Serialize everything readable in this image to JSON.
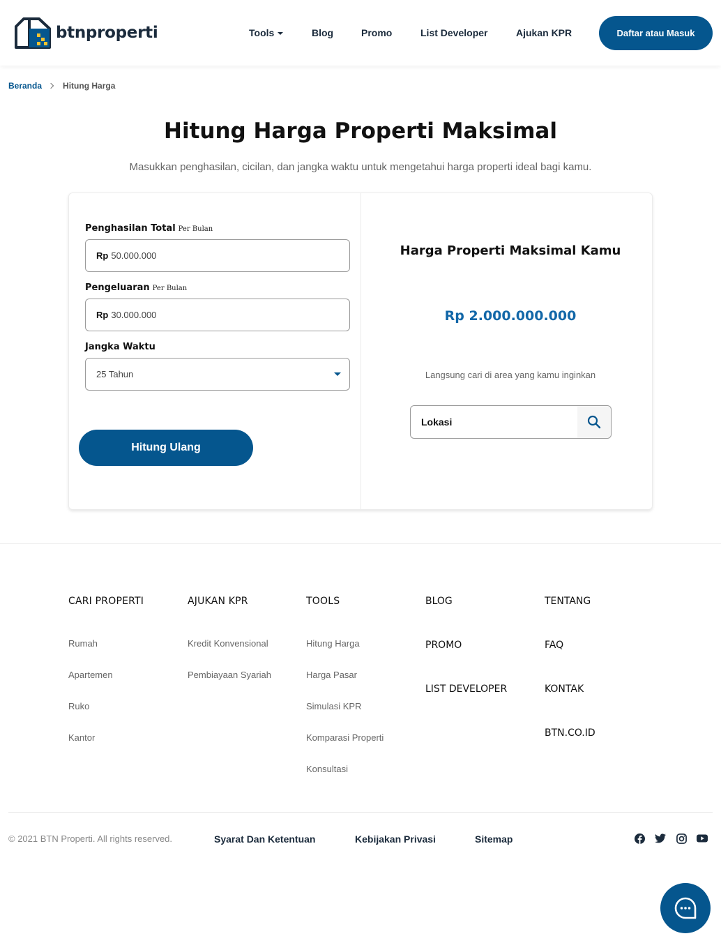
{
  "header": {
    "logo_text": "btnproperti",
    "nav": [
      {
        "label": "Tools",
        "has_dropdown": true
      },
      {
        "label": "Blog"
      },
      {
        "label": "Promo"
      },
      {
        "label": "List Developer"
      },
      {
        "label": "Ajukan KPR"
      }
    ],
    "cta_label": "Daftar atau Masuk"
  },
  "breadcrumb": {
    "home": "Beranda",
    "current": "Hitung Harga"
  },
  "page": {
    "title": "Hitung Harga Properti Maksimal",
    "subtitle": "Masukkan penghasilan, cicilan, dan jangka waktu untuk mengetahui harga properti ideal bagi kamu."
  },
  "form": {
    "income": {
      "label": "Penghasilan Total",
      "unit": "Per Bulan",
      "prefix": "Rp",
      "value": "50.000.000"
    },
    "expense": {
      "label": "Pengeluaran",
      "unit": "Per Bulan",
      "prefix": "Rp",
      "value": "30.000.000"
    },
    "term": {
      "label": "Jangka Waktu",
      "value": "25 Tahun"
    },
    "submit_label": "Hitung Ulang"
  },
  "result": {
    "title": "Harga Properti Maksimal Kamu",
    "value": "Rp 2.000.000.000",
    "hint": "Langsung cari di area yang kamu inginkan",
    "location_value": "Lokasi"
  },
  "footer": {
    "columns": [
      {
        "heading": "CARI PROPERTI",
        "links": [
          "Rumah",
          "Apartemen",
          "Ruko",
          "Kantor"
        ]
      },
      {
        "heading": "AJUKAN KPR",
        "links": [
          "Kredit Konvensional",
          "Pembiayaan Syariah"
        ]
      },
      {
        "heading": "TOOLS",
        "links": [
          "Hitung Harga",
          "Harga Pasar",
          "Simulasi KPR",
          "Komparasi Properti",
          "Konsultasi"
        ]
      }
    ],
    "stack1": [
      "BLOG",
      "PROMO",
      "LIST DEVELOPER"
    ],
    "stack2": [
      "TENTANG",
      "FAQ",
      "KONTAK",
      "BTN.CO.ID"
    ],
    "copyright": "© 2021 BTN Properti. All rights reserved.",
    "legal": [
      "Syarat Dan Ketentuan",
      "Kebijakan Privasi",
      "Sitemap"
    ],
    "social_icons": [
      "facebook-icon",
      "twitter-icon",
      "instagram-icon",
      "youtube-icon"
    ]
  },
  "colors": {
    "primary": "#05568e",
    "result_value": "#1267a8",
    "logo_accent": "#f2c230"
  }
}
